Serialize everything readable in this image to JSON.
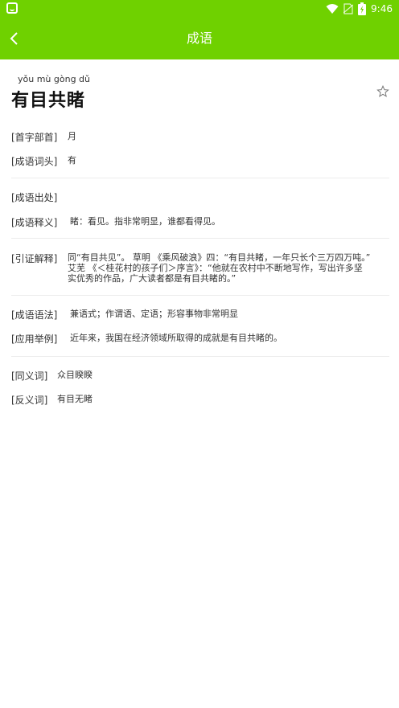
{
  "status": {
    "time": "9:46"
  },
  "appbar": {
    "title": "成语"
  },
  "entry": {
    "pinyin": "yǒu mù gòng dǔ",
    "idiom": "有目共睹"
  },
  "fields": {
    "radical": {
      "label": "[首字部首]",
      "value": "月"
    },
    "head": {
      "label": "[成语词头]",
      "value": "有"
    },
    "source": {
      "label": "[成语出处]",
      "value": ""
    },
    "meaning": {
      "label": "[成语释义]",
      "value": "睹：看见。指非常明显，谁都看得见。"
    },
    "citation": {
      "label": "[引证解释]",
      "lines": [
        "同“有目共见”。 草明 《乘风破浪》四：“有目共睹，一年只长个三万四万吨。”",
        "艾芜 《＜桂花村的孩子们＞序言》：“他就在农村中不断地写作，写出许多坚",
        "实优秀的作品，广大读者都是有目共睹的。”"
      ]
    },
    "usage": {
      "label": "[成语语法]",
      "value": "兼语式；作谓语、定语；形容事物非常明显"
    },
    "example": {
      "label": "[应用举例]",
      "value": "近年来，我国在经济领域所取得的成就是有目共睹的。"
    },
    "synonym": {
      "label": "[同义词]",
      "value": "众目睽睽"
    },
    "antonym": {
      "label": "[反义词]",
      "value": "有目无睹"
    }
  }
}
